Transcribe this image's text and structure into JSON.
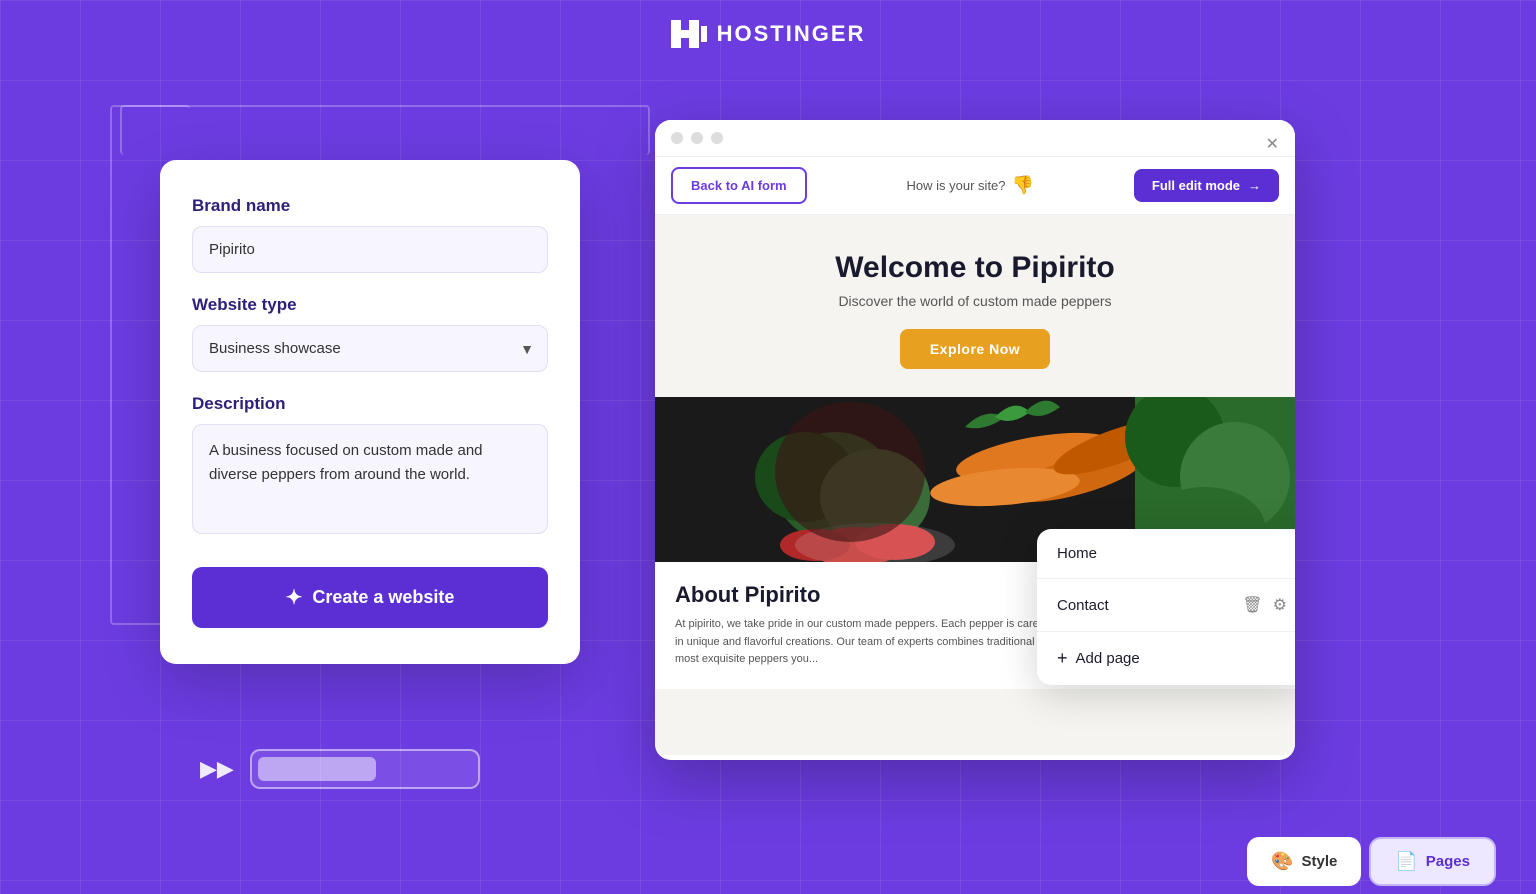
{
  "header": {
    "logo_text": "HOSTINGER"
  },
  "form": {
    "brand_name_label": "Brand name",
    "brand_name_value": "Pipirito",
    "website_type_label": "Website type",
    "website_type_value": "Business showcase",
    "description_label": "Description",
    "description_value": "A business focused on custom made and diverse peppers from around the world.",
    "create_btn_label": "Create a website"
  },
  "browser": {
    "back_btn_label": "Back to AI form",
    "how_is_site_label": "How is your site?",
    "full_edit_label": "Full edit mode",
    "site_title": "Welcome to Pipirito",
    "site_subtitle": "Discover the world of custom made peppers",
    "explore_btn": "Explore Now",
    "about_title": "About Pipirito",
    "about_text": "At pipirito, we take pride in our custom made peppers. Each pepper is carefully selected and crafted to perfection, resulting in unique and flavorful creations. Our team of experts combines traditional techniques with innovative ideas to bring you the most exquisite peppers you..."
  },
  "context_menu": {
    "home_label": "Home",
    "contact_label": "Contact",
    "add_page_label": "Add page"
  },
  "bottom_tabs": {
    "style_label": "Style",
    "pages_label": "Pages"
  }
}
